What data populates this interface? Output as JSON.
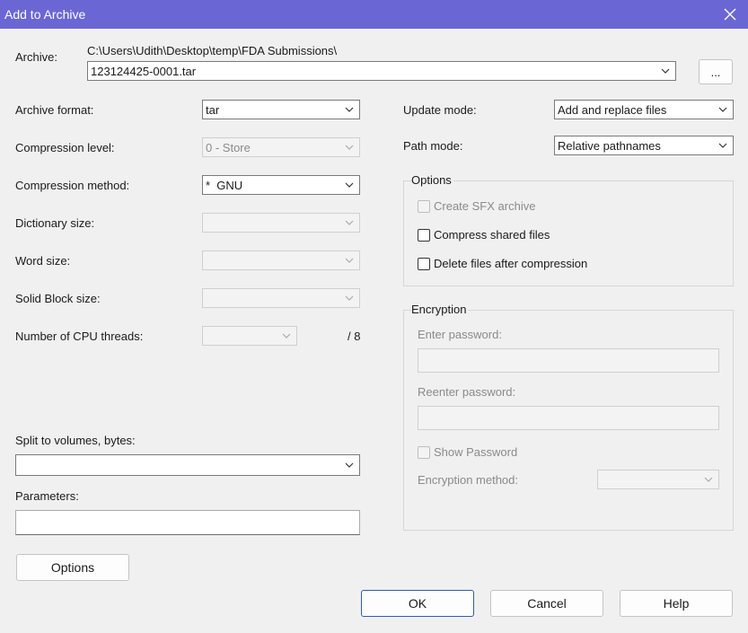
{
  "window": {
    "title": "Add to Archive"
  },
  "archive": {
    "label": "Archive:",
    "path": "C:\\Users\\Udith\\Desktop\\temp\\FDA Submissions\\",
    "filename": "123124425-0001.tar",
    "browse_label": "..."
  },
  "left": {
    "archive_format": {
      "label": "Archive format:",
      "value": "tar"
    },
    "compression_level": {
      "label": "Compression level:",
      "value": "0 - Store"
    },
    "compression_method": {
      "label": "Compression method:",
      "value": "*  GNU"
    },
    "dictionary_size": {
      "label": "Dictionary size:",
      "value": ""
    },
    "word_size": {
      "label": "Word size:",
      "value": ""
    },
    "solid_block_size": {
      "label": "Solid Block size:",
      "value": ""
    },
    "cpu_threads": {
      "label": "Number of CPU threads:",
      "value": "",
      "max": "/ 8"
    },
    "split_volumes": {
      "label": "Split to volumes, bytes:",
      "value": ""
    },
    "parameters": {
      "label": "Parameters:",
      "value": ""
    },
    "options_button": "Options"
  },
  "right": {
    "update_mode": {
      "label": "Update mode:",
      "value": "Add and replace files"
    },
    "path_mode": {
      "label": "Path mode:",
      "value": "Relative pathnames"
    },
    "options_group": {
      "title": "Options",
      "create_sfx": "Create SFX archive",
      "compress_shared": "Compress shared files",
      "delete_after": "Delete files after compression"
    },
    "encryption_group": {
      "title": "Encryption",
      "enter_password": "Enter password:",
      "reenter_password": "Reenter password:",
      "show_password": "Show Password",
      "encryption_method": "Encryption method:"
    }
  },
  "buttons": {
    "ok": "OK",
    "cancel": "Cancel",
    "help": "Help"
  }
}
